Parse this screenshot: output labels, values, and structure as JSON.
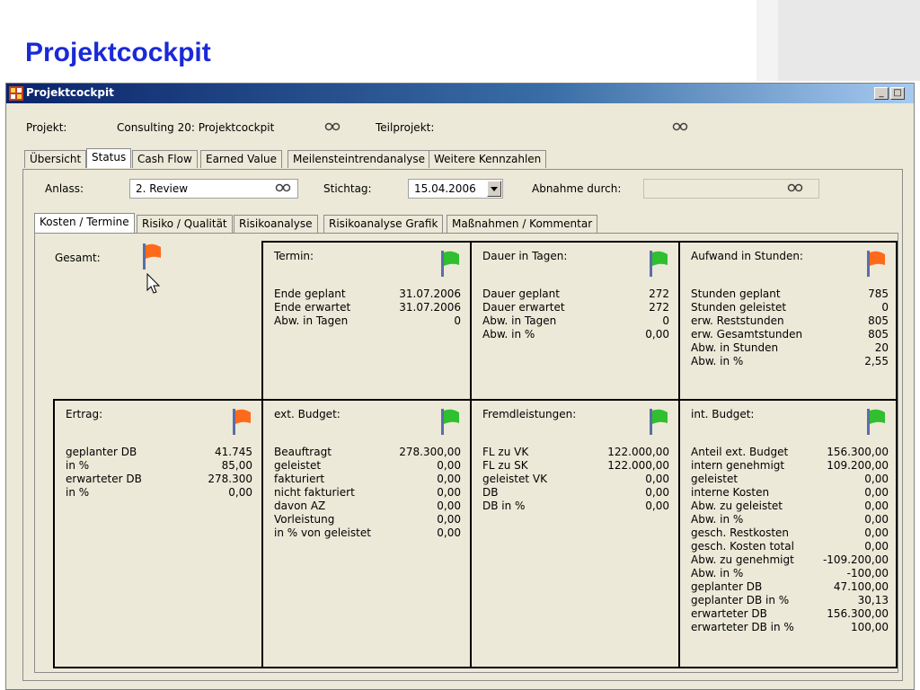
{
  "slide": {
    "title": "Projektcockpit"
  },
  "window": {
    "title": "Projektcockpit",
    "btn_min": "_",
    "btn_max": "□"
  },
  "header": {
    "projekt_label": "Projekt:",
    "projekt_value": "Consulting 20: Projektcockpit",
    "teilprojekt_label": "Teilprojekt:"
  },
  "main_tabs": [
    "Übersicht",
    "Status",
    "Cash Flow",
    "Earned Value",
    "Meilensteintrendanalyse",
    "Weitere Kennzahlen"
  ],
  "status": {
    "anlass_label": "Anlass:",
    "anlass_value": "2. Review",
    "stichtag_label": "Stichtag:",
    "stichtag_value": "15.04.2006",
    "abnahme_label": "Abnahme durch:"
  },
  "sub_tabs": [
    "Kosten / Termine",
    "Risiko / Qualität",
    "Risikoanalyse",
    "Risikoanalyse Grafik",
    "Maßnahmen / Kommentar"
  ],
  "colors": {
    "flag_orange": "#ff6a1a",
    "flag_green": "#2fbf2f",
    "title_blue": "#1a2ad6"
  },
  "gesamt": {
    "label": "Gesamt:",
    "flag": "orange"
  },
  "termin": {
    "title": "Termin:",
    "flag": "green",
    "rows": [
      {
        "label": "Ende geplant",
        "value": "31.07.2006"
      },
      {
        "label": "Ende erwartet",
        "value": "31.07.2006"
      },
      {
        "label": "Abw. in Tagen",
        "value": "0"
      }
    ]
  },
  "dauer": {
    "title": "Dauer in Tagen:",
    "flag": "green",
    "rows": [
      {
        "label": "Dauer geplant",
        "value": "272"
      },
      {
        "label": "Dauer erwartet",
        "value": "272"
      },
      {
        "label": "Abw. in Tagen",
        "value": "0"
      },
      {
        "label": "Abw. in %",
        "value": "0,00"
      }
    ]
  },
  "aufwand": {
    "title": "Aufwand in Stunden:",
    "flag": "orange",
    "rows": [
      {
        "label": "Stunden geplant",
        "value": "785"
      },
      {
        "label": "Stunden geleistet",
        "value": "0"
      },
      {
        "label": "erw. Reststunden",
        "value": "805"
      },
      {
        "label": "erw. Gesamtstunden",
        "value": "805"
      },
      {
        "label": "Abw. in Stunden",
        "value": "20"
      },
      {
        "label": "Abw. in %",
        "value": "2,55"
      }
    ]
  },
  "ertrag": {
    "title": "Ertrag:",
    "flag": "orange",
    "rows": [
      {
        "label": "geplanter DB",
        "value": "41.745"
      },
      {
        "label": "in %",
        "value": "85,00"
      },
      {
        "label": "erwarteter DB",
        "value": "278.300"
      },
      {
        "label": "in %",
        "value": "0,00"
      }
    ]
  },
  "ext_budget": {
    "title": "ext. Budget:",
    "flag": "green",
    "rows": [
      {
        "label": "Beauftragt",
        "value": "278.300,00"
      },
      {
        "label": "geleistet",
        "value": "0,00"
      },
      {
        "label": "fakturiert",
        "value": "0,00"
      },
      {
        "label": "nicht fakturiert",
        "value": "0,00"
      },
      {
        "label": "davon AZ",
        "value": "0,00"
      },
      {
        "label": "Vorleistung",
        "value": "0,00"
      },
      {
        "label": "in % von geleistet",
        "value": "0,00"
      }
    ]
  },
  "fremd": {
    "title": "Fremdleistungen:",
    "flag": "green",
    "rows": [
      {
        "label": "FL zu VK",
        "value": "122.000,00"
      },
      {
        "label": "FL zu SK",
        "value": "122.000,00"
      },
      {
        "label": "geleistet VK",
        "value": "0,00"
      },
      {
        "label": "DB",
        "value": "0,00"
      },
      {
        "label": "DB in %",
        "value": "0,00"
      }
    ]
  },
  "int_budget": {
    "title": "int. Budget:",
    "flag": "green",
    "rows": [
      {
        "label": "Anteil ext. Budget",
        "value": "156.300,00"
      },
      {
        "label": "intern genehmigt",
        "value": "109.200,00"
      },
      {
        "label": "geleistet",
        "value": "0,00"
      },
      {
        "label": "interne Kosten",
        "value": "0,00"
      },
      {
        "label": "Abw. zu geleistet",
        "value": "0,00"
      },
      {
        "label": "Abw. in %",
        "value": "0,00"
      },
      {
        "label": "gesch. Restkosten",
        "value": "0,00"
      },
      {
        "label": "gesch. Kosten total",
        "value": "0,00"
      },
      {
        "label": "Abw. zu genehmigt",
        "value": "-109.200,00"
      },
      {
        "label": "Abw. in %",
        "value": "-100,00"
      },
      {
        "label": "geplanter DB",
        "value": "47.100,00"
      },
      {
        "label": "geplanter DB in %",
        "value": "30,13"
      },
      {
        "label": "erwarteter DB",
        "value": "156.300,00"
      },
      {
        "label": "erwarteter DB in %",
        "value": "100,00"
      }
    ]
  }
}
